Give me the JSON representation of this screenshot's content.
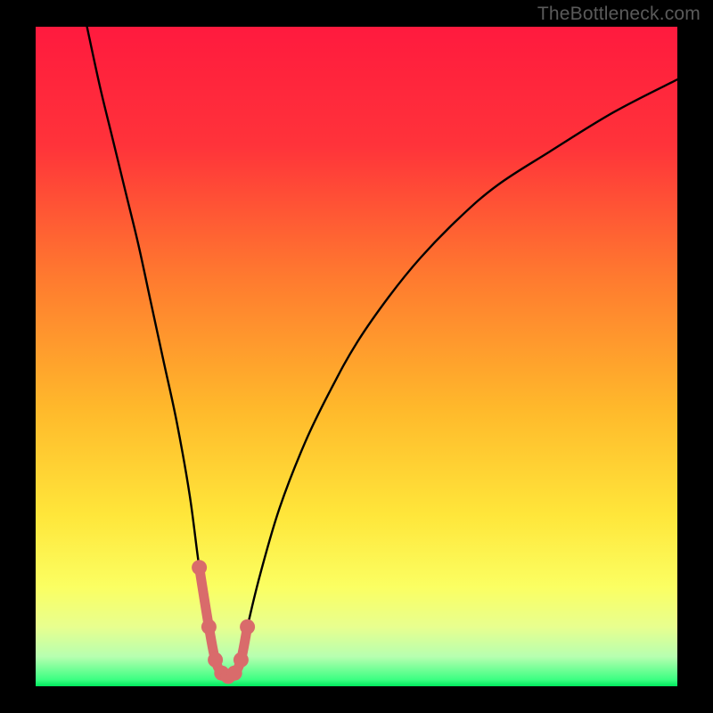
{
  "watermark": "TheBottleneck.com",
  "chart_data": {
    "type": "line",
    "title": "",
    "xlabel": "",
    "ylabel": "",
    "xlim": [
      0,
      100
    ],
    "ylim": [
      0,
      100
    ],
    "grid": false,
    "legend": false,
    "series": [
      {
        "name": "bottleneck-curve",
        "x": [
          8,
          10,
          12,
          14,
          16,
          18,
          20,
          22,
          24,
          25.5,
          27,
          28,
          29,
          30,
          31,
          32,
          33,
          35,
          38,
          42,
          46,
          50,
          55,
          60,
          66,
          72,
          80,
          90,
          100
        ],
        "values": [
          100,
          91,
          83,
          75,
          67,
          58,
          49,
          40,
          29,
          18,
          9,
          4,
          2,
          1.5,
          2,
          4,
          9,
          17,
          27,
          37,
          45,
          52,
          59,
          65,
          71,
          76,
          81,
          87,
          92
        ]
      }
    ],
    "markers": {
      "name": "highlight-points",
      "color": "#d96b6b",
      "x": [
        25.5,
        27,
        28,
        29,
        30,
        31,
        32,
        33
      ],
      "values": [
        18,
        9,
        4,
        2,
        1.5,
        2,
        4,
        9
      ]
    },
    "background_gradient": {
      "type": "vertical",
      "stops": [
        {
          "pos": 0.0,
          "color": "#ff1a3e"
        },
        {
          "pos": 0.18,
          "color": "#ff333a"
        },
        {
          "pos": 0.38,
          "color": "#ff7a2f"
        },
        {
          "pos": 0.58,
          "color": "#ffb92b"
        },
        {
          "pos": 0.74,
          "color": "#ffe63a"
        },
        {
          "pos": 0.85,
          "color": "#fbff62"
        },
        {
          "pos": 0.91,
          "color": "#e8ff8f"
        },
        {
          "pos": 0.955,
          "color": "#b7ffb0"
        },
        {
          "pos": 0.99,
          "color": "#3cff82"
        },
        {
          "pos": 1.0,
          "color": "#00e85e"
        }
      ]
    }
  }
}
